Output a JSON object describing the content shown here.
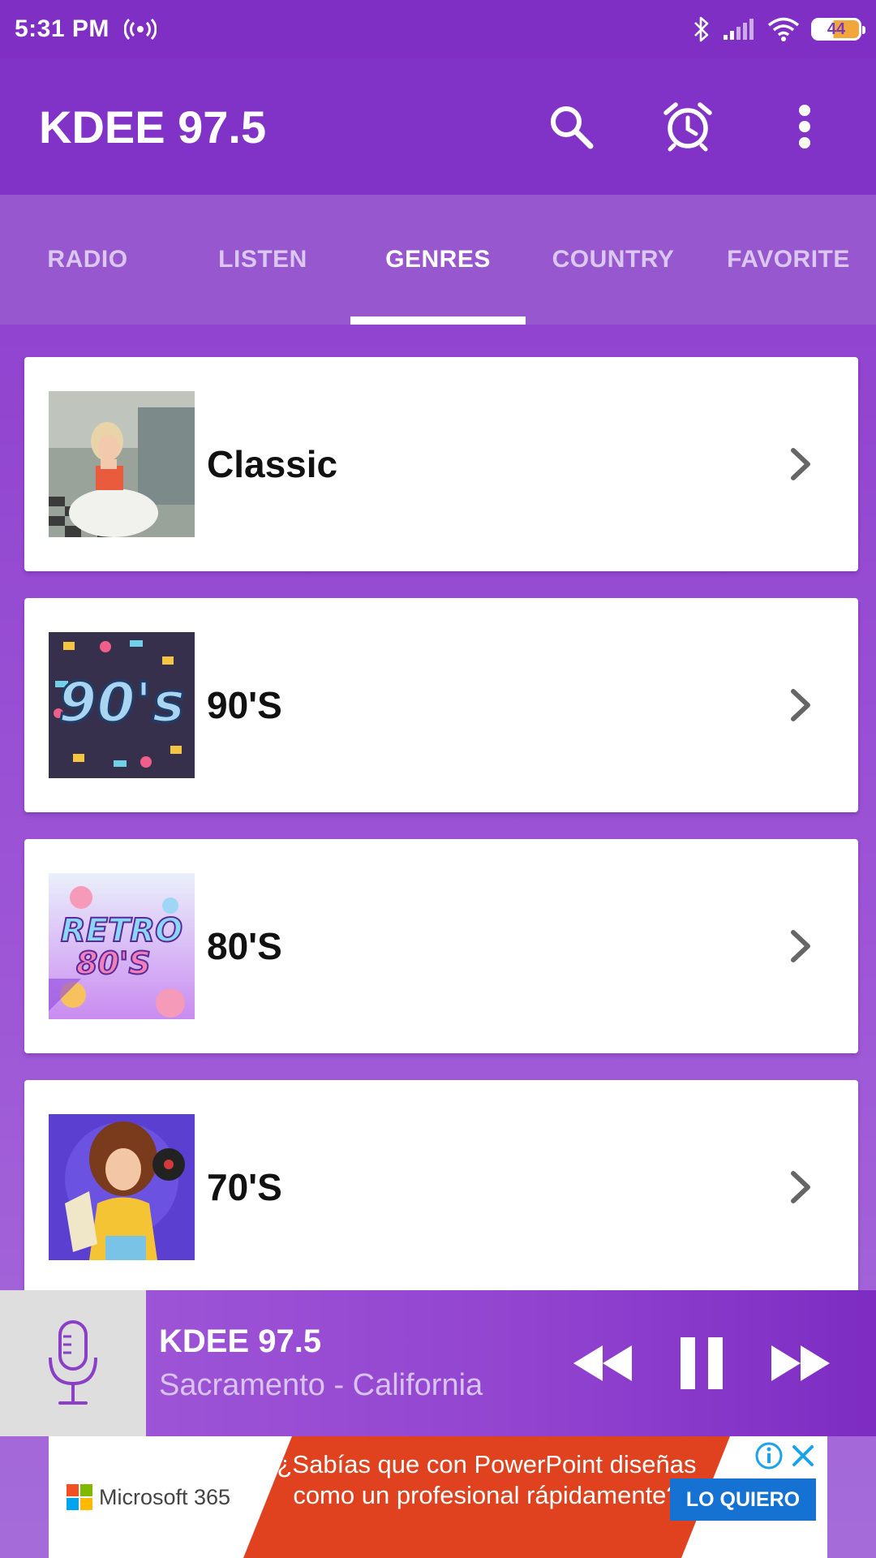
{
  "status_bar": {
    "time": "5:31 PM",
    "battery": "44",
    "icons": [
      "hotspot-icon",
      "bluetooth-icon",
      "signal-icon",
      "wifi-icon",
      "battery-icon"
    ]
  },
  "app_bar": {
    "title": "KDEE 97.5",
    "actions": [
      "search-icon",
      "alarm-icon",
      "more-vert-icon"
    ]
  },
  "tabs": [
    {
      "label": "RADIO",
      "active": false
    },
    {
      "label": "LISTEN",
      "active": false
    },
    {
      "label": "GENRES",
      "active": true
    },
    {
      "label": "COUNTRY",
      "active": false
    },
    {
      "label": "FAVORITE",
      "active": false
    }
  ],
  "genres": [
    {
      "label": "Classic"
    },
    {
      "label": "90'S"
    },
    {
      "label": "80'S"
    },
    {
      "label": "70'S"
    }
  ],
  "player": {
    "title": "KDEE 97.5",
    "subtitle": "Sacramento - California",
    "controls": [
      "rewind-icon",
      "pause-icon",
      "fast-forward-icon"
    ]
  },
  "ad": {
    "brand": "Microsoft 365",
    "headline": "¿Sabías que con PowerPoint diseñas como un profesional rápidamente?",
    "cta": "LO QUIERO"
  },
  "colors": {
    "primary": "#8133c7",
    "tab_bar": "#9758cf",
    "ad_red": "#e0411e",
    "ad_blue": "#1572d3"
  }
}
